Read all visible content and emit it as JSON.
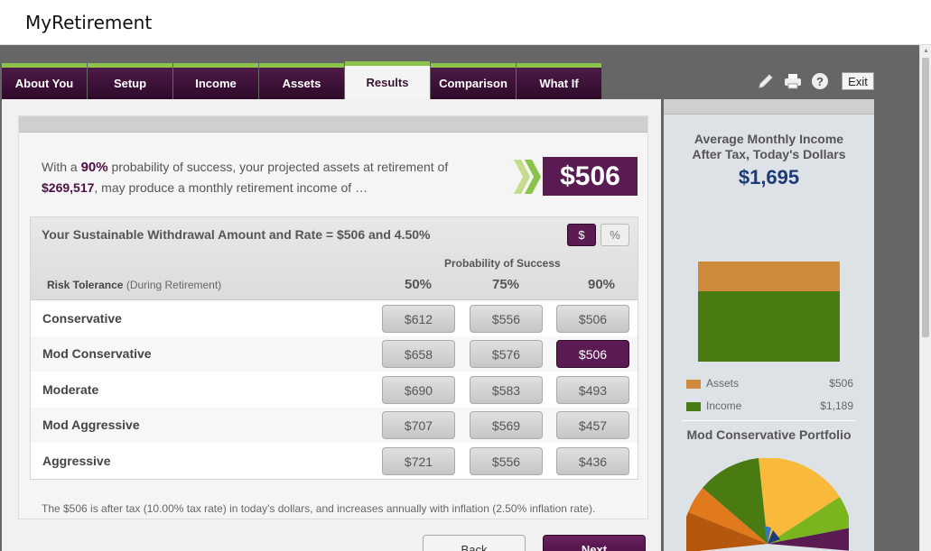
{
  "app": {
    "title": "MyRetirement"
  },
  "tabs": [
    {
      "label": "About You"
    },
    {
      "label": "Setup"
    },
    {
      "label": "Income"
    },
    {
      "label": "Assets"
    },
    {
      "label": "Results",
      "active": true
    },
    {
      "label": "Comparison"
    },
    {
      "label": "What If"
    }
  ],
  "toolbar": {
    "exit_label": "Exit",
    "help_label": "?"
  },
  "intro": {
    "p1": "With a ",
    "probability": "90%",
    "p2": " probability of success, your projected assets at retirement of ",
    "assets": "$269,517",
    "p3": ", may produce a monthly retirement income of …"
  },
  "headline_amount": "$506",
  "table": {
    "title": "Your Sustainable Withdrawal Amount and Rate = $506 and 4.50%",
    "toggle_dollar": "$",
    "toggle_percent": "%",
    "prob_header": "Probability of Success",
    "risk_header_bold": "Risk Tolerance",
    "risk_header_rest": " (During Retirement)",
    "columns": [
      "50%",
      "75%",
      "90%"
    ],
    "rows": [
      {
        "label": "Conservative",
        "values": [
          "$612",
          "$556",
          "$506"
        ]
      },
      {
        "label": "Mod Conservative",
        "values": [
          "$658",
          "$576",
          "$506"
        ]
      },
      {
        "label": "Moderate",
        "values": [
          "$690",
          "$583",
          "$493"
        ]
      },
      {
        "label": "Mod Aggressive",
        "values": [
          "$707",
          "$569",
          "$457"
        ]
      },
      {
        "label": "Aggressive",
        "values": [
          "$721",
          "$556",
          "$436"
        ]
      }
    ],
    "selected": {
      "row": 1,
      "col": 2
    }
  },
  "footnote": "The $506 is after tax (10.00% tax rate) in today's dollars, and increases annually with inflation (2.50% inflation rate).",
  "nav": {
    "back_label": "Back",
    "next_label": "Next"
  },
  "sidebar": {
    "title_line1": "Average Monthly Income",
    "title_line2": "After Tax, Today's Dollars",
    "total": "$1,695",
    "legend": [
      {
        "label": "Assets",
        "value": "$506",
        "color": "#d08a3c"
      },
      {
        "label": "Income",
        "value": "$1,189",
        "color": "#4a7a12"
      }
    ],
    "portfolio_title": "Mod Conservative Portfolio",
    "pie_colors": [
      "#f9b93a",
      "#7ab51d",
      "#5a1b52",
      "#1e3b78",
      "#2e7db4",
      "#8fc7e8",
      "#b5580e",
      "#e07a1c",
      "#4a7a12"
    ]
  },
  "colors": {
    "brand": "#5a1b52",
    "accent": "#8bc34a",
    "total": "#1e3b78"
  }
}
